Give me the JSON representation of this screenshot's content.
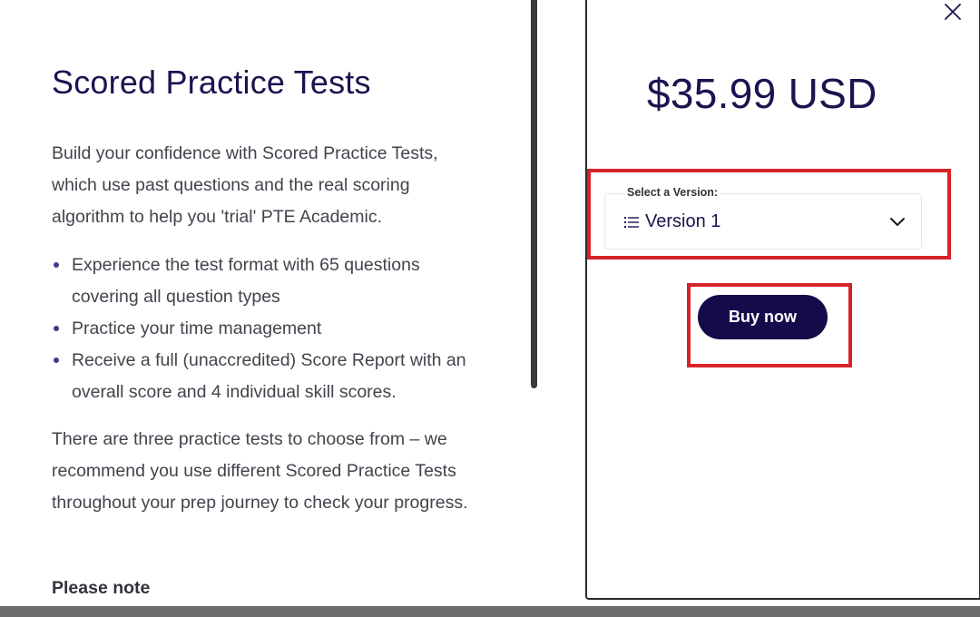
{
  "left": {
    "title": "Scored Practice Tests",
    "intro": "Build your confidence with Scored Practice Tests, which use past questions and the real scoring algorithm to help you 'trial' PTE Academic.",
    "bullets": [
      "Experience the test format with 65 questions covering all question types",
      "Practice your time management",
      "Receive a full (unaccredited) Score Report with an overall score and 4 individual skill scores."
    ],
    "closing": "There are three practice tests to choose from – we recommend you use different Scored Practice Tests throughout your prep journey to check your progress.",
    "note_heading": "Please note"
  },
  "modal": {
    "price": "$35.99 USD",
    "select_label": "Select a Version:",
    "selected_version": "Version 1",
    "buy_label": "Buy now",
    "icons": {
      "close": "close-icon",
      "list": "list-icon",
      "chevron": "chevron-down-icon"
    }
  },
  "colors": {
    "heading": "#1a1450",
    "body_text": "#44434d",
    "button_bg": "#140c4a",
    "highlight": "#d8232a",
    "bullet": "#3f3a8a"
  }
}
